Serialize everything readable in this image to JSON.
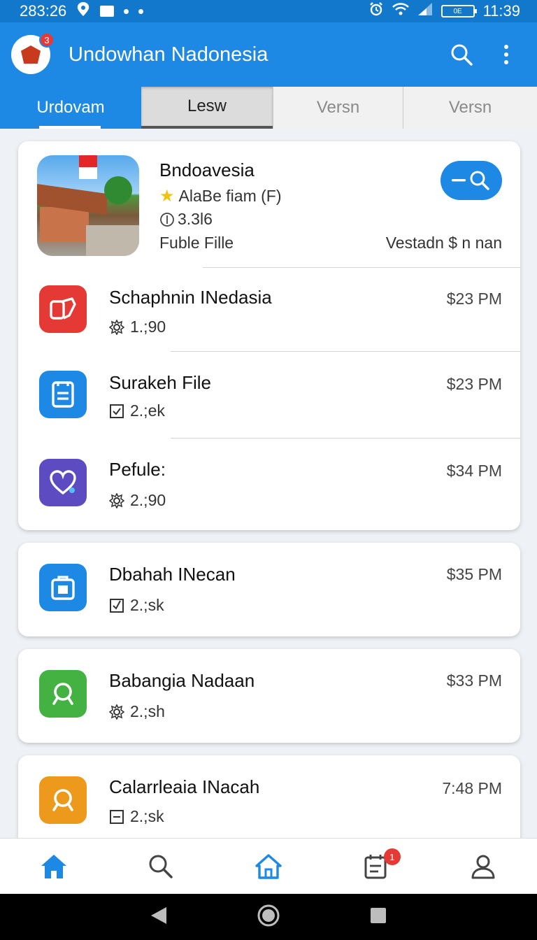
{
  "status_bar": {
    "time_left": "283:26",
    "clock": "11:39",
    "battery_label": "0E"
  },
  "app_bar": {
    "title": "Undowhan Nadonesia",
    "notification_count": "3"
  },
  "tabs": [
    {
      "label": "Urdovam"
    },
    {
      "label": "Lesw"
    },
    {
      "label": "Versn"
    },
    {
      "label": "Versn"
    }
  ],
  "featured": {
    "title": "Bndoavesia",
    "rating_text": "AlaBe fiam (F)",
    "version": "3.3l6",
    "file_label": "Fuble Fille",
    "right_label": "Vestadn $ n nan"
  },
  "list_items": [
    {
      "title_bold": "Schaphnin",
      "title_rest": " INedasia",
      "meta": "1.;90",
      "time": "$23 PM",
      "icon": "open-in-app-icon",
      "color": "#e53935"
    },
    {
      "title_bold": "Surakeh",
      "title_rest": " File",
      "meta": "2.;ek",
      "time": "$23 PM",
      "icon": "document-icon",
      "color": "#1e88e5"
    },
    {
      "title_bold": "Pefule:",
      "title_rest": "",
      "meta": "2.;90",
      "time": "$34 PM",
      "icon": "heart-icon",
      "color": "#5c4bc1"
    },
    {
      "title_bold": "Dbahah",
      "title_rest": " INecan",
      "meta": "2.;sk",
      "time": "$35 PM",
      "icon": "briefcase-icon",
      "color": "#1e88e5"
    },
    {
      "title_bold": "Babangia",
      "title_rest": " Nadaan",
      "meta": "2.;sh",
      "time": "$33 PM",
      "icon": "search-circle-icon",
      "color": "#43b243"
    },
    {
      "title_bold": "Calarrleaia",
      "title_rest": " INacah",
      "meta": "2.;sk",
      "time": "7:48 PM",
      "icon": "search-circle-icon",
      "color": "#ed9a1c"
    }
  ],
  "bottom_nav": {
    "badge_count": "1"
  },
  "colors": {
    "primary": "#1e88e5",
    "status_bar": "#1178cc",
    "badge": "#e53935"
  }
}
